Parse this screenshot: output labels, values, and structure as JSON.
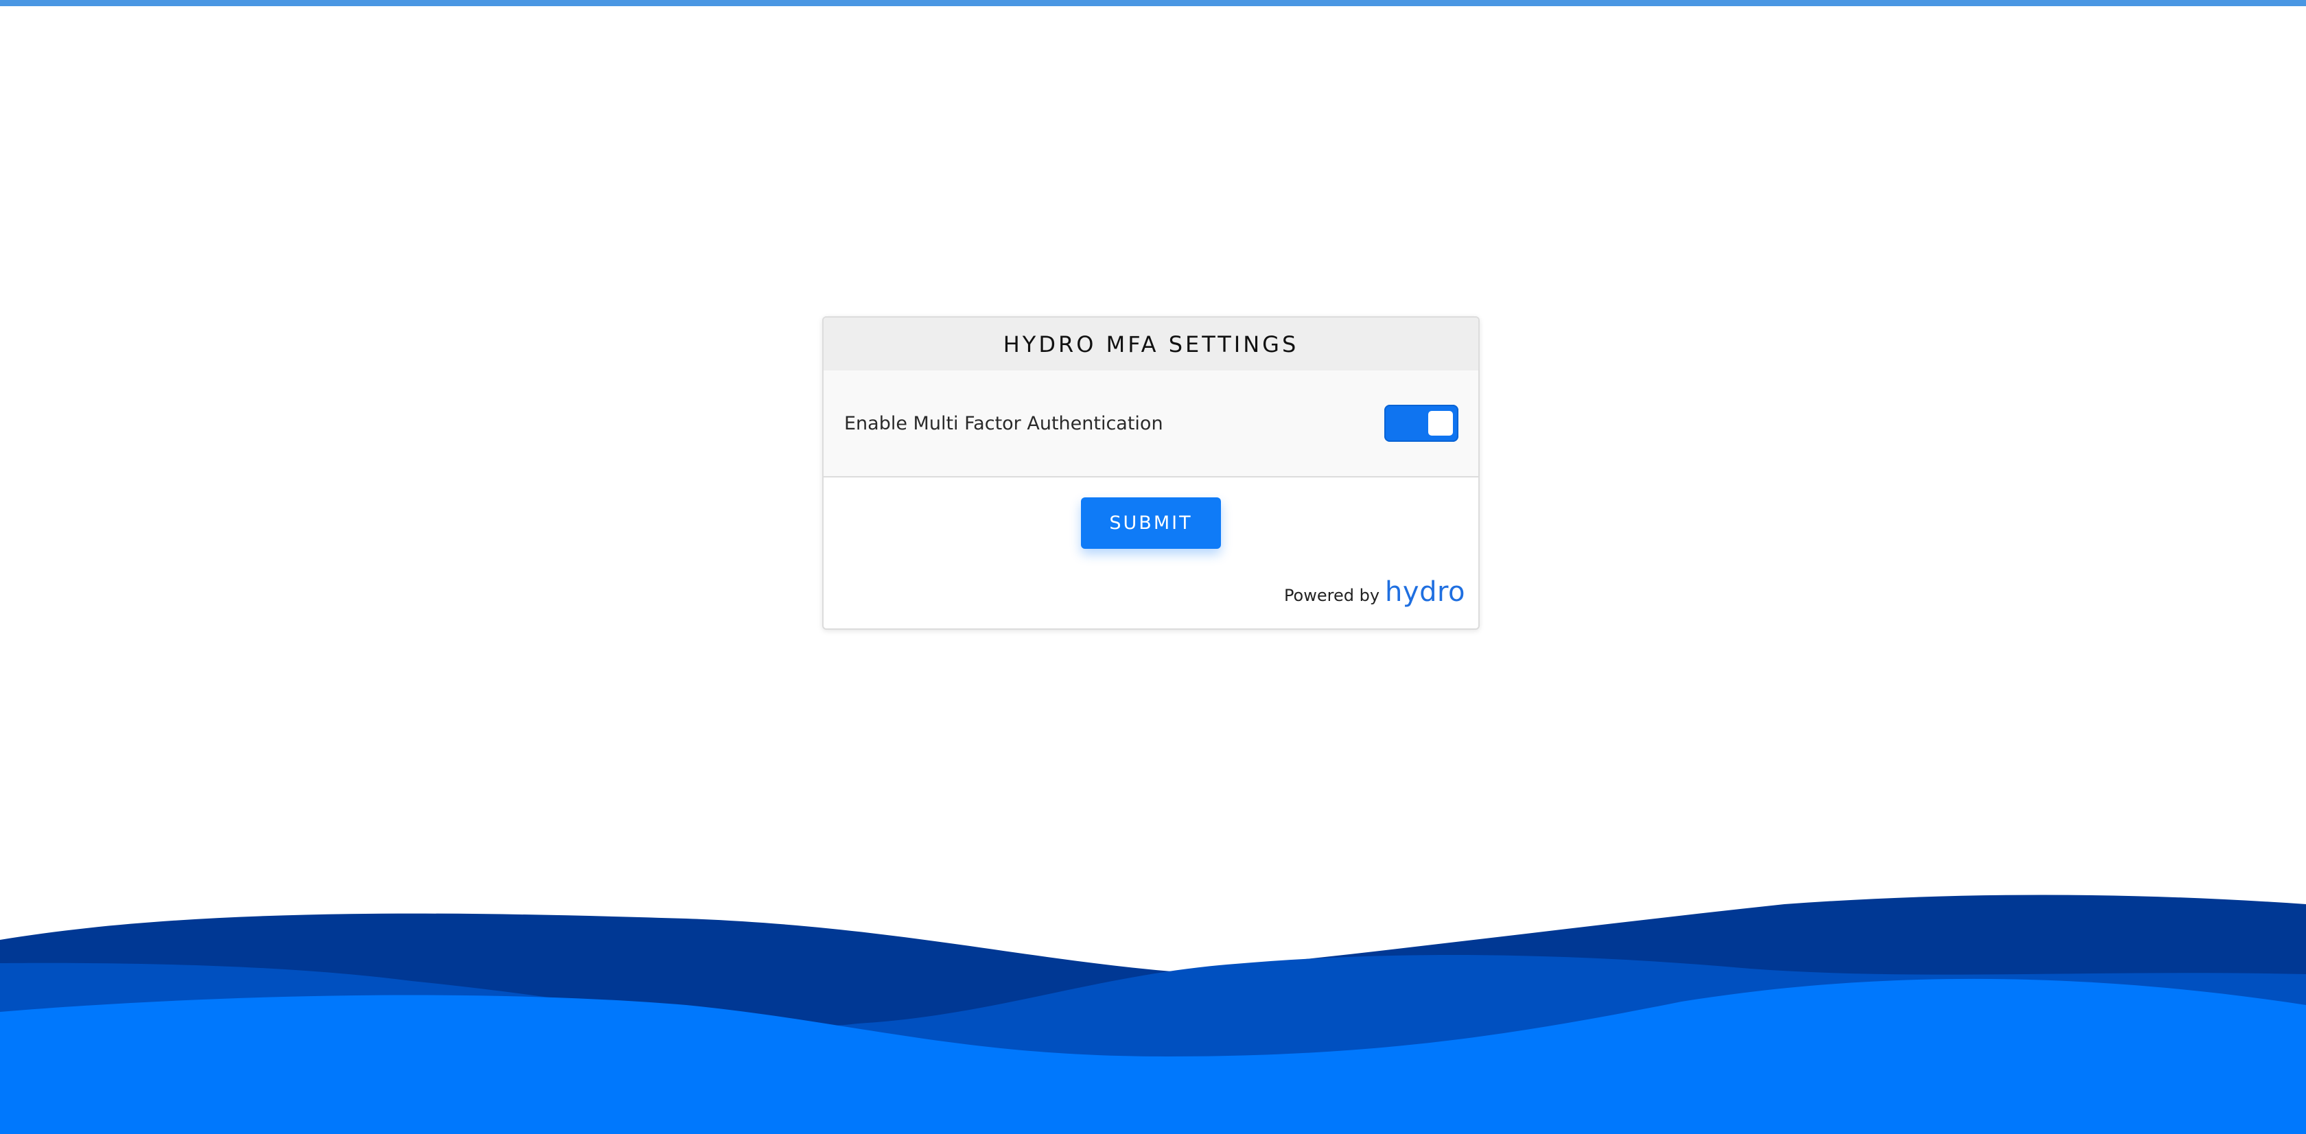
{
  "card": {
    "title": "HYDRO MFA SETTINGS",
    "setting_label": "Enable Multi Factor Authentication",
    "toggle_enabled": true,
    "submit_label": "SUBMIT",
    "powered_by": "Powered by",
    "brand": "hydro"
  },
  "colors": {
    "top_bar": "#4a97e3",
    "primary": "#0f7bf7",
    "wave_dark": "#003894",
    "wave_mid": "#0050c0",
    "wave_light": "#0078fd"
  }
}
